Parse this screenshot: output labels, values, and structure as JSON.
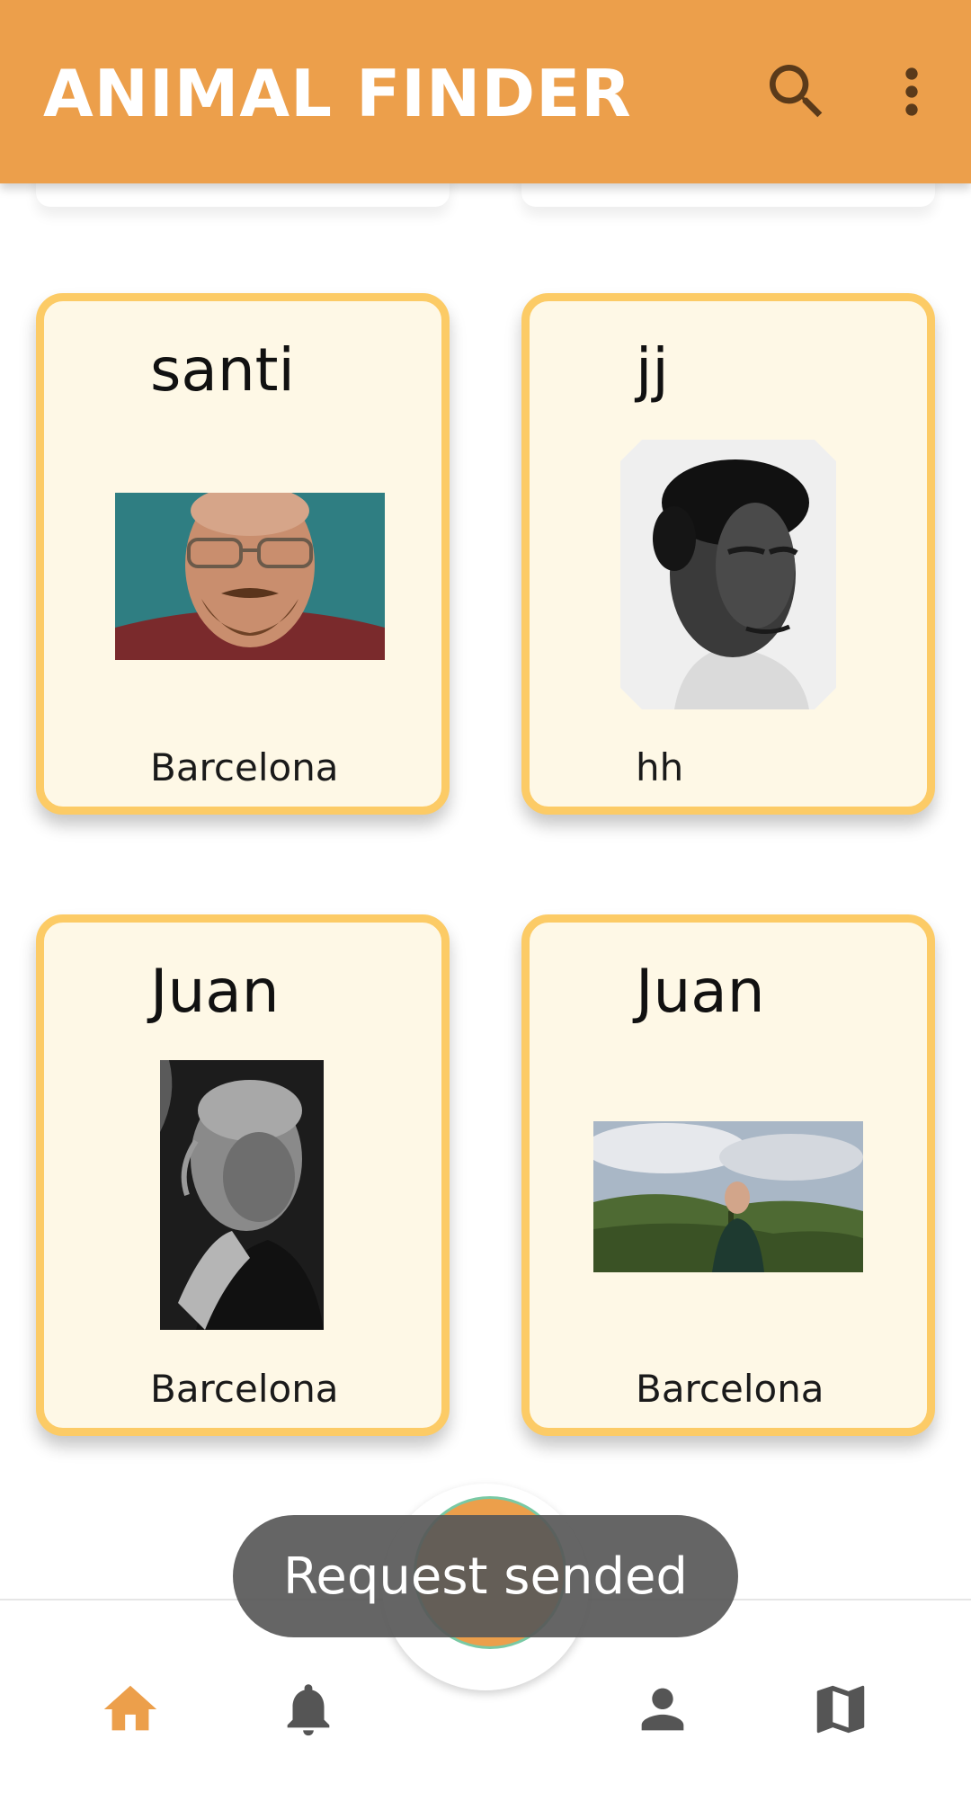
{
  "app_bar": {
    "title": "ANIMAL FINDER",
    "background_color": "#EC9F4B",
    "actions": [
      {
        "icon": "search-icon"
      },
      {
        "icon": "more-vert-icon"
      }
    ]
  },
  "cards": [
    {
      "name": "santi",
      "location": "Barcelona"
    },
    {
      "name": "jj",
      "location": "hh"
    },
    {
      "name": "Juan",
      "location": "Barcelona"
    },
    {
      "name": "Juan",
      "location": "Barcelona"
    }
  ],
  "card_style": {
    "background": "#FEF8E6",
    "border": "#FCCB66"
  },
  "toast": {
    "text": "Request sended"
  },
  "bottom_nav": {
    "items": [
      {
        "icon": "home-icon",
        "active": true
      },
      {
        "icon": "bell-icon",
        "active": false
      },
      {
        "icon": "person-icon",
        "active": false
      },
      {
        "icon": "map-icon",
        "active": false
      }
    ],
    "active_color": "#EC9F4B",
    "inactive_color": "#555555"
  }
}
